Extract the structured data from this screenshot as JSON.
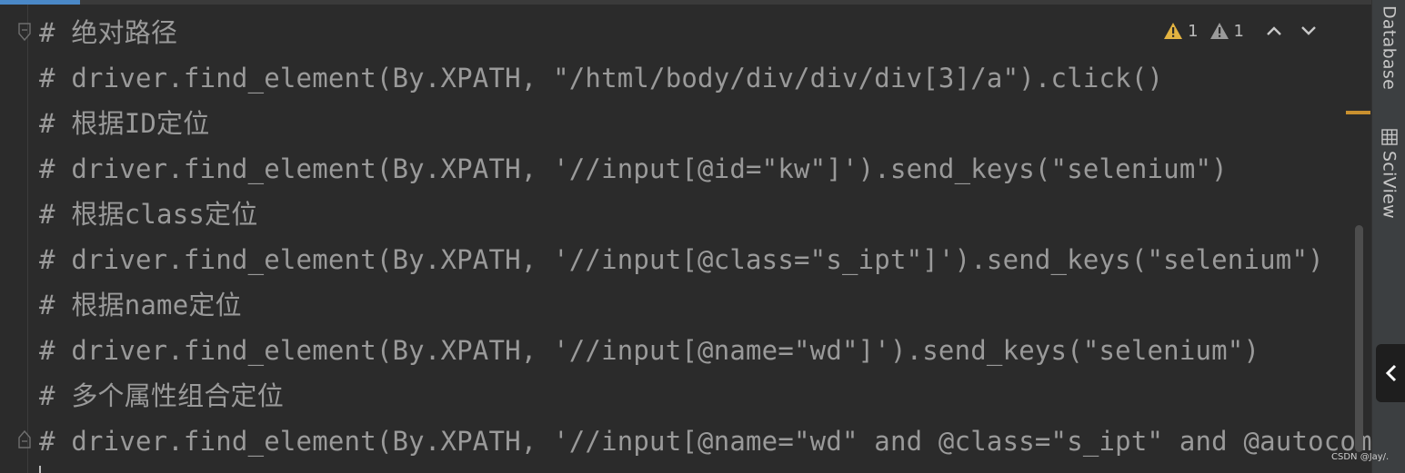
{
  "editor": {
    "lines": [
      "# 绝对路径",
      "# driver.find_element(By.XPATH, \"/html/body/div/div/div[3]/a\").click()",
      "# 根据ID定位",
      "# driver.find_element(By.XPATH, '//input[@id=\"kw\"]').send_keys(\"selenium\")",
      "# 根据class定位",
      "# driver.find_element(By.XPATH, '//input[@class=\"s_ipt\"]').send_keys(\"selenium\")",
      "# 根据name定位",
      "# driver.find_element(By.XPATH, '//input[@name=\"wd\"]').send_keys(\"selenium\")",
      "# 多个属性组合定位",
      "# driver.find_element(By.XPATH, '//input[@name=\"wd\" and @class=\"s_ipt\" and @autocomplete"
    ],
    "comment_color": "#9a9a9a",
    "background_color": "#2b2b2b"
  },
  "inspections": {
    "warnings_count": "1",
    "weak_warnings_count": "1",
    "warning_icon": "warning-triangle-icon",
    "weak_warning_icon": "weak-warning-triangle-icon",
    "prev_icon": "chevron-up-icon",
    "next_icon": "chevron-down-icon",
    "warning_color": "#e3b341",
    "weak_warning_color": "#9b9b9b"
  },
  "right_panel": {
    "tabs": [
      {
        "label": "Database",
        "icon": ""
      },
      {
        "label": "SciView",
        "icon": "sciview-grid-icon"
      }
    ],
    "collapse_icon": "chevron-left-icon"
  },
  "watermark": "CSDN @Jay/."
}
